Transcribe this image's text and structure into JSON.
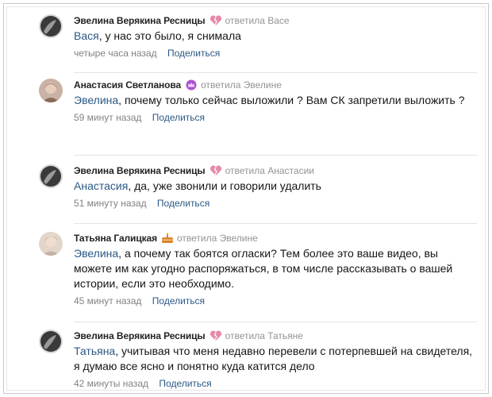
{
  "comments": [
    {
      "author": "Эвелина Верякина Ресницы",
      "badge": "broken-heart-icon",
      "replied": "ответила Васе",
      "mention": "Вася",
      "text": ", у нас это было, я снимала",
      "time": "четыре часа назад",
      "share": "Поделиться"
    },
    {
      "author": "Анастасия Светланова",
      "badge": "crown-icon",
      "replied": "ответила Эвелине",
      "mention": "Эвелина",
      "text": ", почему только сейчас выложили ? Вам СК запретили выложить ?",
      "time": "59 минут назад",
      "share": "Поделиться"
    },
    {
      "author": "Эвелина Верякина Ресницы",
      "badge": "broken-heart-icon",
      "replied": "ответила Анастасии",
      "mention": "Анастасия",
      "text": ", да, уже звонили и говорили удалить",
      "time": "51 минуту назад",
      "share": "Поделиться"
    },
    {
      "author": "Татьяна Галицкая",
      "badge": "cake-icon",
      "replied": "ответила Эвелине",
      "mention": "Эвелина",
      "text": ", а почему так боятся огласки? Тем более это ваше видео, вы можете им как угодно распоряжаться, в том числе рассказывать о вашей истории, если это необходимо.",
      "time": "45 минут назад",
      "share": "Поделиться"
    },
    {
      "author": "Эвелина Верякина Ресницы",
      "badge": "broken-heart-icon",
      "replied": "ответила Татьяне",
      "mention": "Татьяна",
      "text": ", учитывая что меня недавно перевели с потерпевшей на свидетеля, я думаю все ясно и понятно куда катится дело",
      "time": "42 минуты назад",
      "share": "Поделиться"
    }
  ],
  "colors": {
    "link": "#2a5885",
    "muted": "#939393",
    "author": "#222222",
    "separator": "#e3e4e8",
    "badge_heart": "#e68aa9",
    "badge_crown": "#b04fd0",
    "badge_cake": "#d9822b"
  }
}
